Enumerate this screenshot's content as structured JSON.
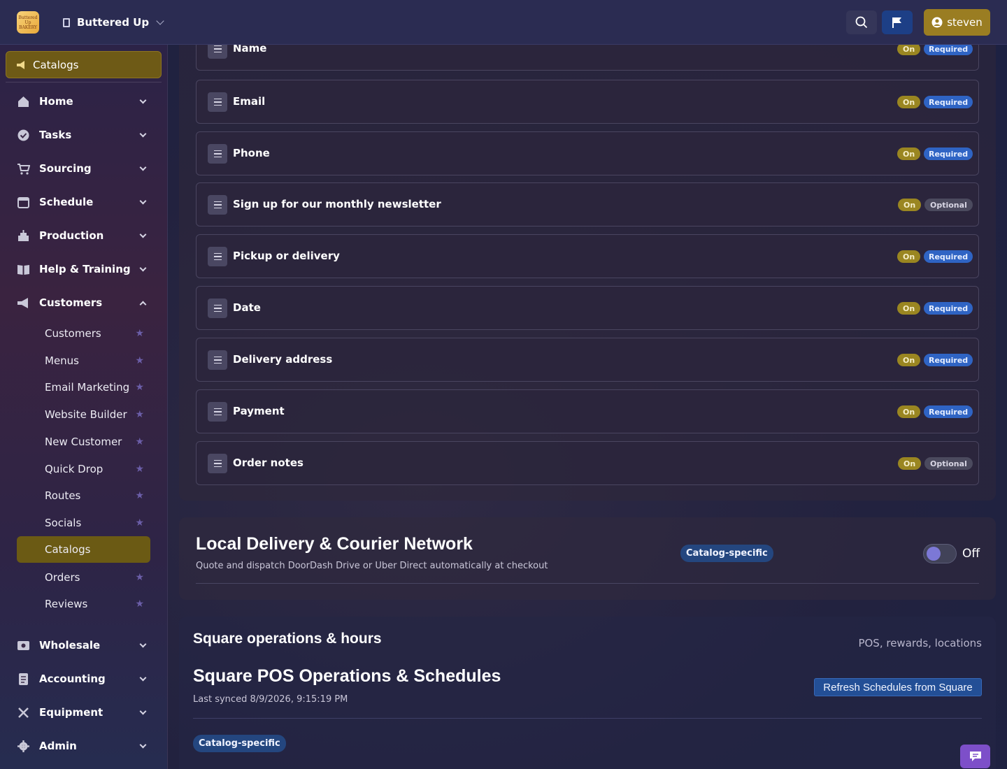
{
  "header": {
    "logo_text": "Buttered Up BAKERY",
    "org_name": "Buttered Up",
    "user_name": "steven"
  },
  "sidebar": {
    "current": "Catalogs",
    "items": [
      {
        "label": "Home",
        "icon": "home-icon"
      },
      {
        "label": "Tasks",
        "icon": "check-circle-icon"
      },
      {
        "label": "Sourcing",
        "icon": "cart-icon"
      },
      {
        "label": "Schedule",
        "icon": "calendar-icon"
      },
      {
        "label": "Production",
        "icon": "cake-icon"
      },
      {
        "label": "Help & Training",
        "icon": "book-icon"
      },
      {
        "label": "Customers",
        "icon": "megaphone-icon",
        "expanded": true
      },
      {
        "label": "Wholesale",
        "icon": "store-icon"
      },
      {
        "label": "Accounting",
        "icon": "receipt-icon"
      },
      {
        "label": "Equipment",
        "icon": "tools-icon"
      },
      {
        "label": "Admin",
        "icon": "gear-icon"
      }
    ],
    "customers_sub": [
      {
        "label": "Customers"
      },
      {
        "label": "Menus"
      },
      {
        "label": "Email Marketing"
      },
      {
        "label": "Website Builder"
      },
      {
        "label": "New Customer"
      },
      {
        "label": "Quick Drop"
      },
      {
        "label": "Routes"
      },
      {
        "label": "Socials"
      },
      {
        "label": "Catalogs",
        "active": true
      },
      {
        "label": "Orders"
      },
      {
        "label": "Reviews"
      }
    ]
  },
  "fields": [
    {
      "name": "Name",
      "status": "On",
      "requirement": "Required"
    },
    {
      "name": "Email",
      "status": "On",
      "requirement": "Required"
    },
    {
      "name": "Phone",
      "status": "On",
      "requirement": "Required"
    },
    {
      "name": "Sign up for our monthly newsletter",
      "status": "On",
      "requirement": "Optional"
    },
    {
      "name": "Pickup or delivery",
      "status": "On",
      "requirement": "Required"
    },
    {
      "name": "Date",
      "status": "On",
      "requirement": "Required"
    },
    {
      "name": "Delivery address",
      "status": "On",
      "requirement": "Required"
    },
    {
      "name": "Payment",
      "status": "On",
      "requirement": "Required"
    },
    {
      "name": "Order notes",
      "status": "On",
      "requirement": "Optional"
    }
  ],
  "delivery": {
    "title": "Local Delivery & Courier Network",
    "subtitle": "Quote and dispatch DoorDash Drive or Uber Direct automatically at checkout",
    "badge": "Catalog-specific",
    "toggle_label": "Off",
    "enabled": false
  },
  "square": {
    "section_title": "Square operations & hours",
    "section_right": "POS, rewards, locations",
    "title": "Square POS Operations & Schedules",
    "last_synced": "Last synced 8/9/2026, 9:15:19 PM",
    "refresh_label": "Refresh Schedules from Square",
    "badge": "Catalog-specific"
  },
  "colors": {
    "accent_gold": "#9a7d22",
    "required_blue": "#2f64c4",
    "flag_blue": "#1d3f86",
    "chat_purple": "#7d4fc9"
  }
}
